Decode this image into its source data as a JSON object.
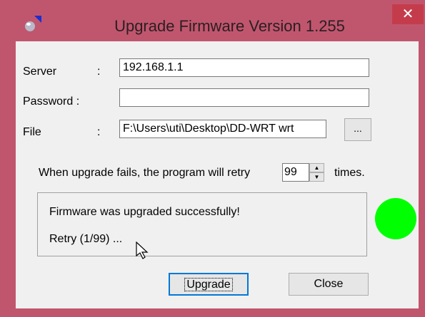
{
  "window": {
    "title": "Upgrade Firmware Version 1.255",
    "close_glyph": "✕",
    "title_bar_color": "#c0566e"
  },
  "form": {
    "server_label": "Server",
    "password_label": "Password :",
    "file_label": "File",
    "colon": ":",
    "server_value": "192.168.1.1",
    "password_value": "",
    "file_value": "F:\\Users\\uti\\Desktop\\DD-WRT wrt",
    "browse_label": "..."
  },
  "retry": {
    "prefix": "When upgrade fails, the program will retry",
    "value": "99",
    "suffix": "times."
  },
  "status": {
    "line1": "Firmware was upgraded successfully!",
    "line2": "Retry (1/99) ...",
    "indicator_color": "#00ff00"
  },
  "buttons": {
    "upgrade": "Upgrade",
    "close": "Close"
  }
}
